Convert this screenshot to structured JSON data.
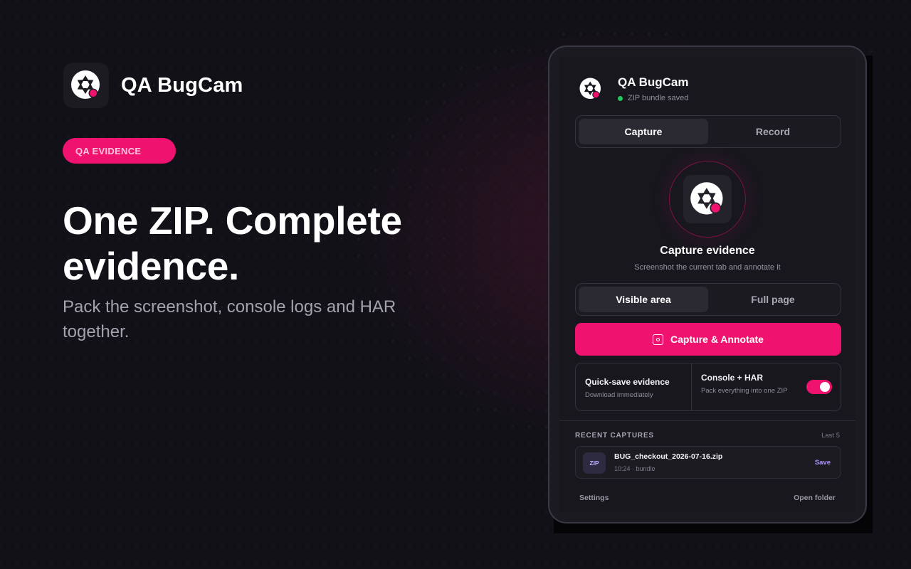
{
  "brand": {
    "name": "QA BugCam",
    "logo_icon": "camera-shutter-icon"
  },
  "badge": {
    "label": "QA EVIDENCE"
  },
  "hero": {
    "headline": "One ZIP. Complete evidence.",
    "subline": "Pack the screenshot, console logs and HAR together."
  },
  "popup": {
    "title": "QA BugCam",
    "status": "ZIP bundle saved",
    "mode_tabs": [
      {
        "label": "Capture",
        "active": true
      },
      {
        "label": "Record",
        "active": false
      }
    ],
    "hero_icon": "camera-shutter-icon",
    "hero_title": "Capture evidence",
    "hero_sub": "Screenshot the current tab and annotate it",
    "area_tabs": [
      {
        "label": "Visible area",
        "active": true
      },
      {
        "label": "Full page",
        "active": false
      }
    ],
    "cta_label": "Capture & Annotate",
    "options": {
      "quick_save": {
        "title": "Quick-save evidence",
        "desc": "Download immediately"
      },
      "console_har": {
        "title": "Console + HAR",
        "desc": "Pack everything into one ZIP",
        "enabled": true
      }
    },
    "recent": {
      "heading": "RECENT CAPTURES",
      "count_label": "Last 5",
      "items": [
        {
          "type": "ZIP",
          "name": "BUG_checkout_2026-07-16.zip",
          "meta": "10:24 · bundle",
          "action": "Save"
        }
      ]
    },
    "footer": {
      "settings": "Settings",
      "open_folder": "Open folder"
    }
  },
  "colors": {
    "accent": "#f0126f",
    "background": "#121118",
    "panel": "#18171e",
    "status_ok": "#22c55e",
    "link": "#b197ff"
  }
}
